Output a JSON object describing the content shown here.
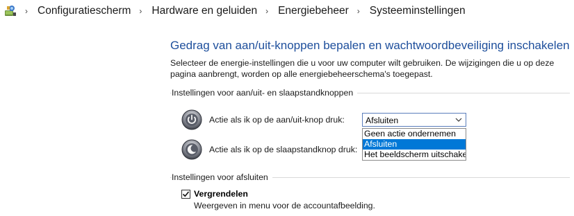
{
  "breadcrumb": {
    "items": [
      "Configuratiescherm",
      "Hardware en geluiden",
      "Energiebeheer",
      "Systeeminstellingen"
    ]
  },
  "main": {
    "title": "Gedrag van aan/uit-knoppen bepalen en wachtwoordbeveiliging inschakelen",
    "description": "Selecteer de energie-instellingen die u voor uw computer wilt gebruiken. De wijzigingen die u op deze pagina aanbrengt, worden op alle energiebeheerschema's toegepast."
  },
  "buttons_section": {
    "label": "Instellingen voor aan/uit- en slaapstandknoppen",
    "power_button_label": "Actie als ik op de aan/uit-knop druk:",
    "power_button_value": "Afsluiten",
    "sleep_button_label": "Actie als ik op de slaapstandknop druk:",
    "dropdown_options": [
      "Geen actie ondernemen",
      "Afsluiten",
      "Het beeldscherm uitschakelen"
    ],
    "dropdown_selected": "Afsluiten"
  },
  "shutdown_section": {
    "label": "Instellingen voor afsluiten",
    "lock_label": "Vergrendelen",
    "lock_checked": true,
    "lock_description": "Weergeven in menu voor de accountafbeelding."
  },
  "colors": {
    "title": "#1e4f9c",
    "selection": "#0078d7"
  }
}
